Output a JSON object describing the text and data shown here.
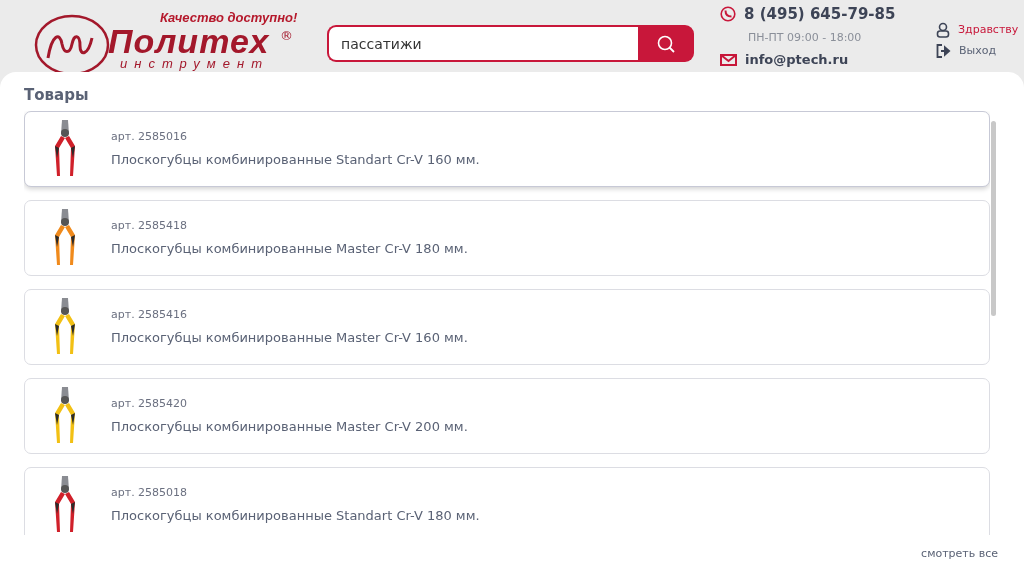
{
  "header": {
    "logo": {
      "slogan": "Качество доступно!",
      "name": "Политех",
      "registered": "®",
      "subtitle": "инструмент"
    },
    "search": {
      "value": "пассатижи"
    },
    "contacts": {
      "phone": "8 (495) 645-79-85",
      "hours": "ПН-ПТ 09:00 - 18:00",
      "email": "info@ptech.ru"
    },
    "user": {
      "greeting": "Здравству",
      "logout": "Выход"
    }
  },
  "section_title": "Товары",
  "products": [
    {
      "article": "арт. 2585016",
      "name": "Плоскогубцы комбинированные Standart Cr-V 160 мм.",
      "selected": true,
      "kind": "picture",
      "color": "#d0202a"
    },
    {
      "article": "арт. 2585418",
      "name": "Плоскогубцы комбинированные Master Cr-V 180 мм.",
      "selected": false,
      "kind": "picture",
      "color": "#f08a1c"
    },
    {
      "article": "арт. 2585416",
      "name": "Плоскогубцы комбинированные Master Cr-V 160 мм.",
      "selected": false,
      "kind": "picture",
      "color": "#f2c014"
    },
    {
      "article": "арт. 2585420",
      "name": "Плоскогубцы комбинированные Master Cr-V 200 мм.",
      "selected": false,
      "kind": "picture",
      "color": "#f2c014"
    },
    {
      "article": "арт. 2585018",
      "name": "Плоскогубцы комбинированные Standart Cr-V 180 мм.",
      "selected": false,
      "kind": "picture",
      "color": "#d0202a"
    }
  ],
  "see_all": "смотреть все"
}
